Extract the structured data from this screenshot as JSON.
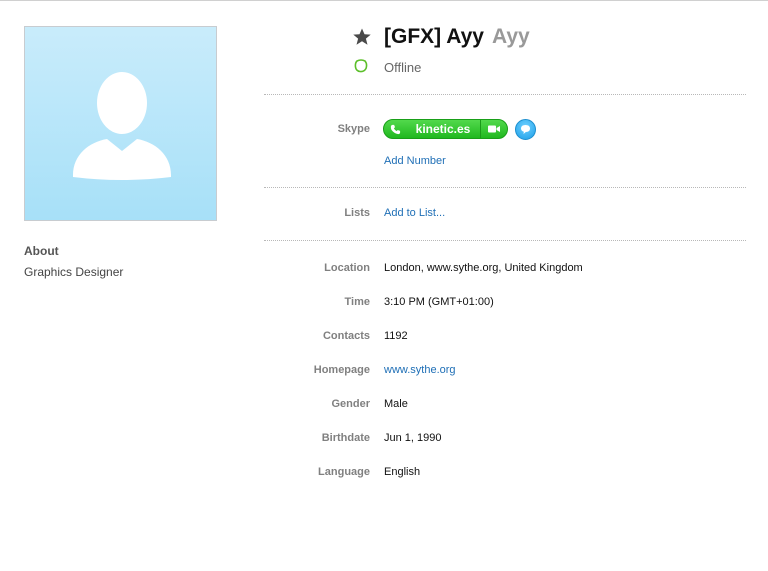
{
  "profile": {
    "display_name": "[GFX] Ayy",
    "nickname": "Ayy",
    "status": "Offline"
  },
  "about": {
    "label": "About",
    "value": "Graphics Designer"
  },
  "skype": {
    "label": "Skype",
    "handle": "kinetic.es",
    "add_number": "Add Number"
  },
  "lists": {
    "label": "Lists",
    "add_to_list": "Add to List..."
  },
  "details": {
    "location_label": "Location",
    "location": "London, www.sythe.org, United Kingdom",
    "time_label": "Time",
    "time": "3:10 PM (GMT+01:00)",
    "contacts_label": "Contacts",
    "contacts": "1192",
    "homepage_label": "Homepage",
    "homepage": "www.sythe.org",
    "gender_label": "Gender",
    "gender": "Male",
    "birthdate_label": "Birthdate",
    "birthdate": "Jun 1, 1990",
    "language_label": "Language",
    "language": "English"
  },
  "icons": {
    "favorite": "star-icon",
    "presence": "presence-offline-icon",
    "call": "phone-icon",
    "video": "video-camera-icon",
    "chat": "chat-bubble-icon",
    "avatar": "default-avatar-silhouette"
  },
  "colors": {
    "call_button": "#22b922",
    "chat_button": "#1c9fe8",
    "link": "#1f6fb6",
    "offline_status": "#5cbf2a"
  }
}
